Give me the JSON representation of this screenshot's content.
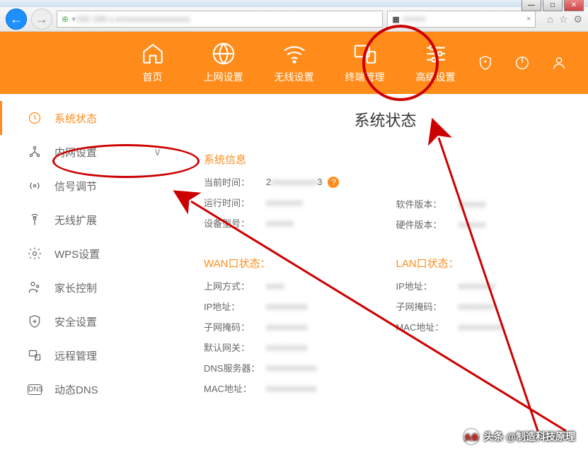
{
  "window": {
    "minimize": "—",
    "maximize": "□",
    "close": "✕"
  },
  "browser": {
    "shield_icon": "⊕",
    "url_separator": "▾",
    "tab_close": "×",
    "home_icon": "⌂",
    "star_icon": "☆",
    "gear_icon": "⚙"
  },
  "topnav": {
    "items": [
      {
        "label": "首页"
      },
      {
        "label": "上网设置"
      },
      {
        "label": "无线设置"
      },
      {
        "label": "终端管理"
      },
      {
        "label": "高级设置"
      }
    ]
  },
  "sidebar": {
    "items": [
      {
        "label": "系统状态"
      },
      {
        "label": "内网设置"
      },
      {
        "label": "信号调节"
      },
      {
        "label": "无线扩展"
      },
      {
        "label": "WPS设置"
      },
      {
        "label": "家长控制"
      },
      {
        "label": "安全设置"
      },
      {
        "label": "远程管理"
      },
      {
        "label": "动态DNS"
      }
    ],
    "expand_chevron": "∨"
  },
  "main": {
    "page_title": "系统状态",
    "sys_info_title": "系统信息",
    "sys_info": {
      "current_time_label": "当前时间：",
      "current_time_prefix": "2",
      "current_time_suffix": "3",
      "uptime_label": "运行时间：",
      "model_label": "设备型号：",
      "sw_version_label": "软件版本：",
      "hw_version_label": "硬件版本："
    },
    "wan_title": "WAN口状态：",
    "wan": {
      "method_label": "上网方式：",
      "ip_label": "IP地址：",
      "mask_label": "子网掩码：",
      "gateway_label": "默认网关：",
      "dns_label": "DNS服务器：",
      "mac_label": "MAC地址："
    },
    "lan_title": "LAN口状态：",
    "lan": {
      "ip_label": "IP地址：",
      "mask_label": "子网掩码：",
      "mac_label": "MAC地址："
    },
    "help_icon": "?"
  },
  "watermark": {
    "badge": "头条",
    "text": "头条 @制造科技原理"
  }
}
